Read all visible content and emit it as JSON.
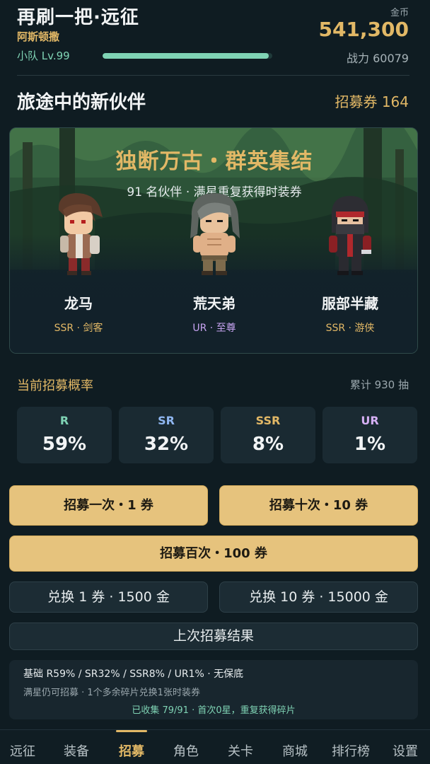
{
  "header": {
    "game_title": "再刷一把·远征",
    "player_name": "阿斯顿撒",
    "team_level": "小队 Lv.99",
    "exp_progress": 0.98,
    "gold_label": "金币",
    "gold_value": "541,300",
    "power": "战力 60079"
  },
  "section": {
    "title": "旅途中的新伙伴",
    "tickets": "招募券 164"
  },
  "banner": {
    "title": "独断万古・群英集结",
    "subtitle": "91 名伙伴 · 满星重复获得时装券",
    "characters": [
      {
        "name": "龙马",
        "rarity": "SSR · 剑客",
        "rarity_color": "#e2b866"
      },
      {
        "name": "荒天弟",
        "rarity": "UR · 至尊",
        "rarity_color": "#c6a3f0"
      },
      {
        "name": "服部半藏",
        "rarity": "SSR · 游侠",
        "rarity_color": "#e2b866"
      }
    ]
  },
  "rates": {
    "title": "当前招募概率",
    "total": "累计 930 抽",
    "items": [
      {
        "label": "R",
        "value": "59%",
        "color": "#7fd3b4"
      },
      {
        "label": "SR",
        "value": "32%",
        "color": "#8fb6f0"
      },
      {
        "label": "SSR",
        "value": "8%",
        "color": "#e2b866"
      },
      {
        "label": "UR",
        "value": "1%",
        "color": "#d6b0f5"
      }
    ]
  },
  "actions": {
    "recruit_1": "招募一次・1 券",
    "recruit_10": "招募十次・10 券",
    "recruit_100": "招募百次・100 券",
    "exchange_1": "兑换 1 券 · 1500 金",
    "exchange_10": "兑换 10 券 · 15000 金",
    "last_result": "上次招募结果"
  },
  "info": {
    "line1": "基础 R59% / SR32% / SSR8% / UR1% · 无保底",
    "line2": "满星仍可招募 · 1个多余碎片兑换1张时装券",
    "line3": "已收集 79/91 · 首次0星，重复获得碎片"
  },
  "nav": {
    "items": [
      "远征",
      "装备",
      "招募",
      "角色",
      "关卡",
      "商城",
      "排行榜",
      "设置"
    ],
    "active": "招募"
  },
  "colors": {
    "accent_gold": "#e2b866",
    "accent_green": "#7fd3b4",
    "background": "#0f1c22"
  }
}
